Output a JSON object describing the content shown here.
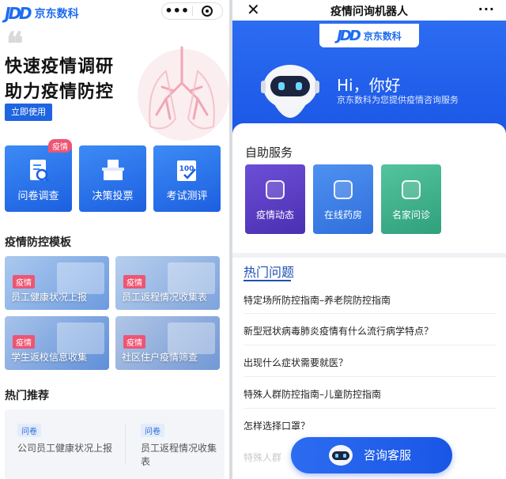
{
  "left": {
    "logo": {
      "mark": "JDD",
      "name": "京东数科"
    },
    "capsule": {
      "more_icon": "more-dots-icon",
      "target_icon": "target-icon"
    },
    "hero": {
      "line1": "快速疫情调研",
      "line2": "助力疫情防控",
      "button": "立即使用"
    },
    "services": [
      {
        "label": "问卷调查",
        "tag": "疫情",
        "icon": "search-doc-icon"
      },
      {
        "label": "决策投票",
        "icon": "ballot-box-icon"
      },
      {
        "label": "考试测评",
        "icon": "score-100-icon"
      }
    ],
    "templates_title": "疫情防控模板",
    "templates": [
      {
        "tag": "疫情",
        "title": "员工健康状况上报"
      },
      {
        "tag": "疫情",
        "title": "员工返程情况收集表"
      },
      {
        "tag": "疫情",
        "title": "学生返校信息收集"
      },
      {
        "tag": "疫情",
        "title": "社区住户疫情筛查"
      }
    ],
    "hot_title": "热门推荐",
    "hot_items": [
      {
        "tag": "问卷",
        "title": "公司员工健康状况上报"
      },
      {
        "tag": "问卷",
        "title": "员工返程情况收集表"
      }
    ]
  },
  "right": {
    "close_icon": "close-icon",
    "title": "疫情问询机器人",
    "more": "···",
    "logo": {
      "mark": "JDD",
      "name": "京东数科"
    },
    "greeting": "Hi，你好",
    "greeting_sub": "京东数科为您提供疫情咨询服务",
    "self_service_title": "自助服务",
    "self_services": [
      {
        "label": "疫情动态",
        "icon": "phone-alert-icon",
        "color": "#5b3fc4"
      },
      {
        "label": "在线药房",
        "icon": "medicine-icon",
        "color": "#3f7fe6"
      },
      {
        "label": "名家问诊",
        "icon": "doctor-icon",
        "color": "#3fb08c"
      }
    ],
    "hot_title": "热门问题",
    "questions": [
      "特定场所防控指南–养老院防控指南",
      "新型冠状病毒肺炎疫情有什么流行病学特点？",
      "出现什么症状需要就医？",
      "特殊人群防控指南–儿童防控指南",
      "怎样选择口罩？",
      "特殊人群"
    ],
    "consult_button": "咨询客服"
  }
}
